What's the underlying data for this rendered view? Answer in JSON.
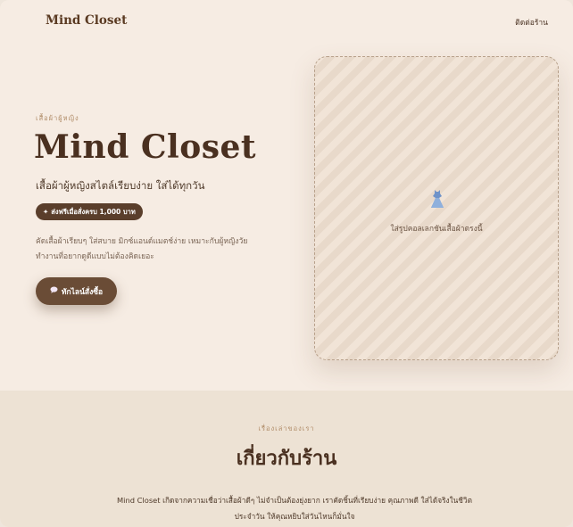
{
  "header": {
    "brand": "Mind Closet",
    "contact_link": "ติดต่อร้าน"
  },
  "hero": {
    "eyebrow": "เสื้อผ้าผู้หญิง",
    "title": "Mind Closet",
    "subtitle": "เสื้อผ้าผู้หญิงสไตล์เรียบง่าย ใส่ได้ทุกวัน",
    "promo_badge": "ส่งฟรีเมื่อสั่งครบ 1,000 บาท",
    "promo_icon": "sparkle-icon",
    "description": "คัดเสื้อผ้าเรียบๆ ใส่สบาย มิกซ์แอนด์แมตช์ง่าย เหมาะกับผู้หญิงวัยทำงานที่อยากดูดีแบบไม่ต้องคิดเยอะ",
    "cta_label": "ทักไลน์สั่งซื้อ",
    "cta_icon": "speech-bubble-icon"
  },
  "photo_placeholder": {
    "icon": "dress-icon",
    "caption": "ใส่รูปคอลเลกชันเสื้อผ้าตรงนี้"
  },
  "about": {
    "eyebrow": "เรื่องเล่าของเรา",
    "title": "เกี่ยวกับร้าน",
    "text": "Mind Closet เกิดจากความเชื่อว่าเสื้อผ้าดีๆ ไม่จำเป็นต้องยุ่งยาก เราคัดชิ้นที่เรียบง่าย คุณภาพดี ใส่ได้จริงในชีวิตประจำวัน ให้คุณหยิบใส่วันไหนก็มั่นใจ"
  },
  "colors": {
    "accent": "#5a3e2b",
    "background": "#f6ece3",
    "about_background": "#ede2d4"
  }
}
